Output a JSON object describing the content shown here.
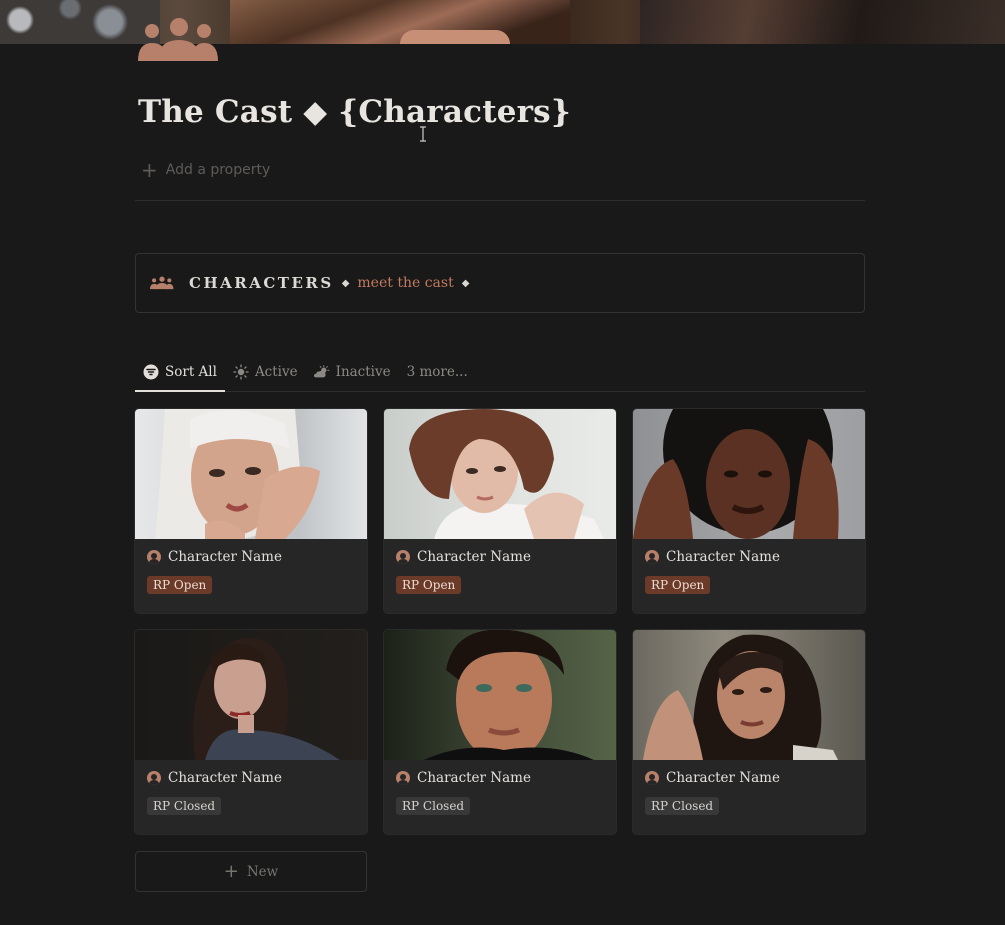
{
  "page": {
    "title": "The Cast ◆ {Characters}",
    "add_property": "Add a property",
    "page_icon": "people-group-icon"
  },
  "callout": {
    "icon": "people-group-icon",
    "heading": "CHARACTERS",
    "separator": "◆",
    "subtitle": "meet the cast",
    "trailing": "◆"
  },
  "tabs": [
    {
      "label": "Sort All",
      "icon": "filter-icon",
      "active": true
    },
    {
      "label": "Active",
      "icon": "sun-icon",
      "active": false
    },
    {
      "label": "Inactive",
      "icon": "cloud-sun-icon",
      "active": false
    },
    {
      "label": "3 more...",
      "icon": "",
      "active": false
    }
  ],
  "cards": [
    {
      "name": "Character Name",
      "status": "RP Open"
    },
    {
      "name": "Character Name",
      "status": "RP Open"
    },
    {
      "name": "Character Name",
      "status": "RP Open"
    },
    {
      "name": "Character Name",
      "status": "RP Closed"
    },
    {
      "name": "Character Name",
      "status": "RP Closed"
    },
    {
      "name": "Character Name",
      "status": "RP Closed"
    }
  ],
  "new_button": {
    "label": "New"
  },
  "colors": {
    "background": "#191919",
    "accent": "#c27a60",
    "tag_open": "#6b3a29",
    "tag_closed": "#383838"
  }
}
